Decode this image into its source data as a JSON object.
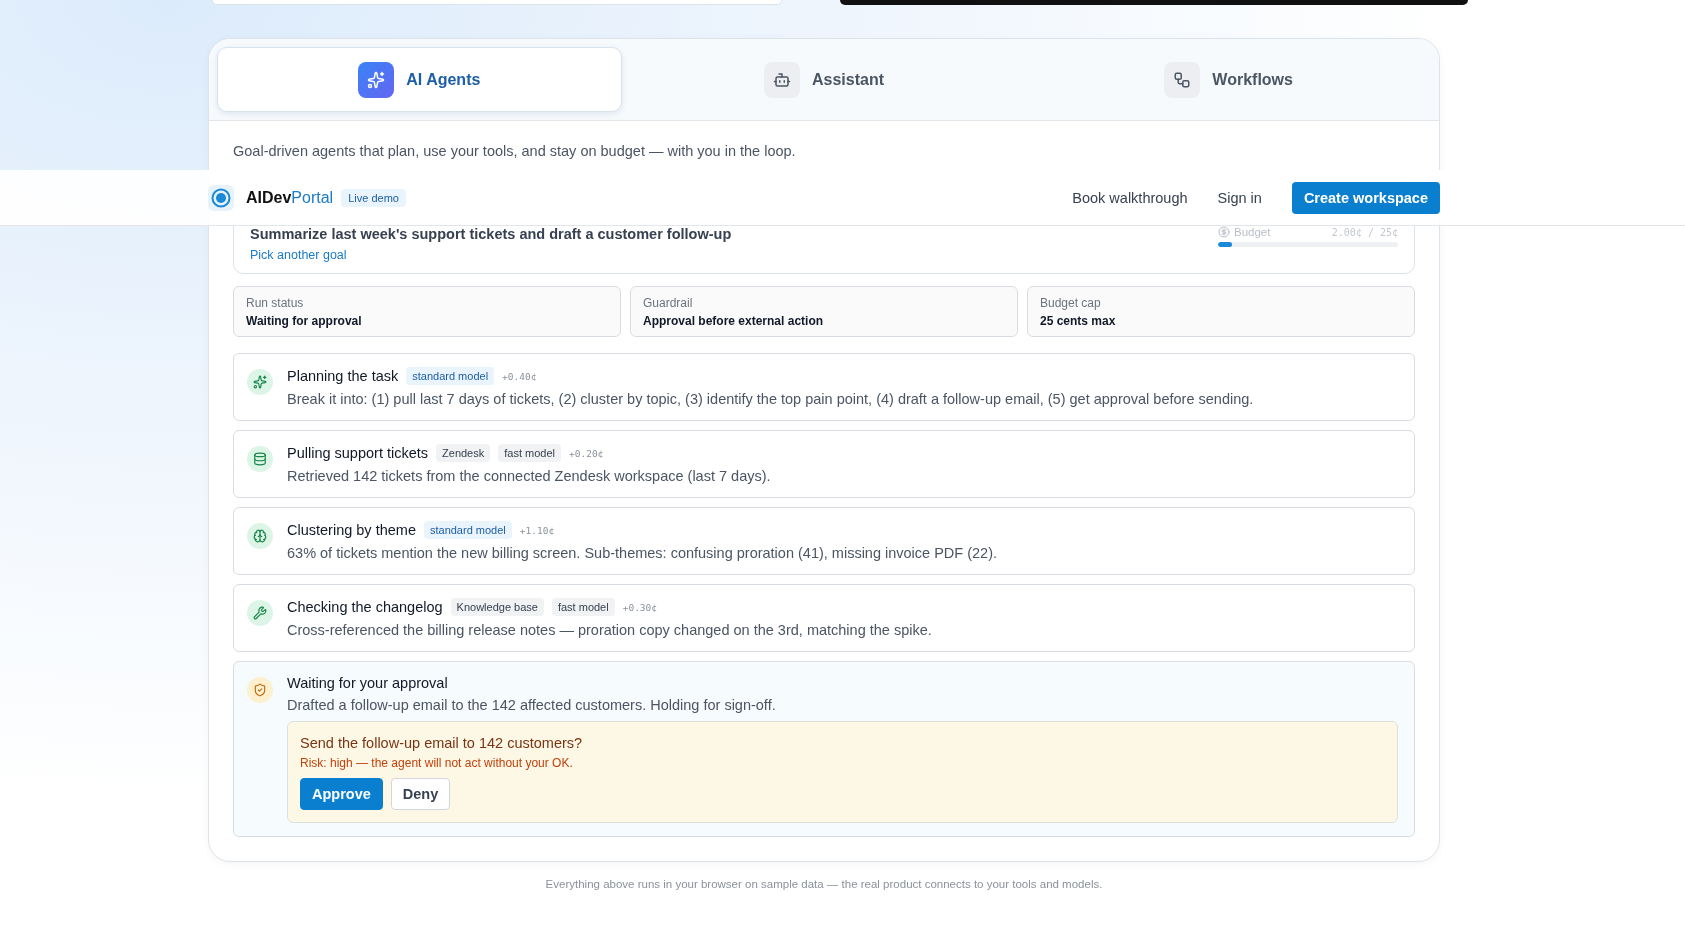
{
  "nav": {
    "brand": {
      "main": "AIDev",
      "accent": "Portal"
    },
    "badge": "Live demo",
    "links": [
      "Book walkthrough",
      "Sign in"
    ],
    "cta": "Create workspace"
  },
  "tabs": [
    {
      "label": "AI Agents",
      "selected": true
    },
    {
      "label": "Assistant",
      "selected": false
    },
    {
      "label": "Workflows",
      "selected": false
    }
  ],
  "description": "Goal-driven agents that plan, use your tools, and stay on budget — with you in the loop.",
  "goal": {
    "text": "Summarize last week's support tickets and draft a customer follow-up",
    "link": "Pick another goal",
    "budget_label": "Budget",
    "budget_value": "2.00¢ / 25¢",
    "level": 0.08
  },
  "status_cards": [
    {
      "label": "Run status",
      "value": "Waiting for approval"
    },
    {
      "label": "Guardrail",
      "value": "Approval before external action"
    },
    {
      "label": "Budget cap",
      "value": "25 cents max"
    }
  ],
  "steps": [
    {
      "kind": "done",
      "title": "Planning the task",
      "tags": [
        {
          "label": "standard model",
          "kind": "model"
        }
      ],
      "cost": "+0.40¢",
      "text": "Break it into: (1) pull last 7 days of tickets, (2) cluster by topic, (3) identify the top pain point, (4) draft a follow-up email, (5) get approval before sending."
    },
    {
      "kind": "done",
      "title": "Pulling support tickets",
      "tags": [
        {
          "label": "Zendesk",
          "kind": "plain"
        },
        {
          "label": "fast model",
          "kind": "plain"
        }
      ],
      "cost": "+0.20¢",
      "text": "Retrieved 142 tickets from the connected Zendesk workspace (last 7 days)."
    },
    {
      "kind": "done",
      "title": "Clustering by theme",
      "tags": [
        {
          "label": "standard model",
          "kind": "model"
        }
      ],
      "cost": "+1.10¢",
      "text": "63% of tickets mention the new billing screen. Sub-themes: confusing proration (41), missing invoice PDF (22)."
    },
    {
      "kind": "done",
      "title": "Checking the changelog",
      "tags": [
        {
          "label": "Knowledge base",
          "kind": "plain"
        },
        {
          "label": "fast model",
          "kind": "plain"
        }
      ],
      "cost": "+0.30¢",
      "text": "Cross-referenced the billing release notes — proration copy changed on the 3rd, matching the spike."
    },
    {
      "kind": "approval",
      "title": "Waiting for your approval",
      "text": "Drafted a follow-up email to the 142 affected customers. Holding for sign-off.",
      "approval": {
        "question": "Send the follow-up email to 142 customers?",
        "risk": "Risk: high — the agent will not act without your OK.",
        "approve": "Approve",
        "deny": "Deny"
      }
    }
  ],
  "footer": "Everything above runs in your browser on sample data — the real product connects to your tools and models."
}
